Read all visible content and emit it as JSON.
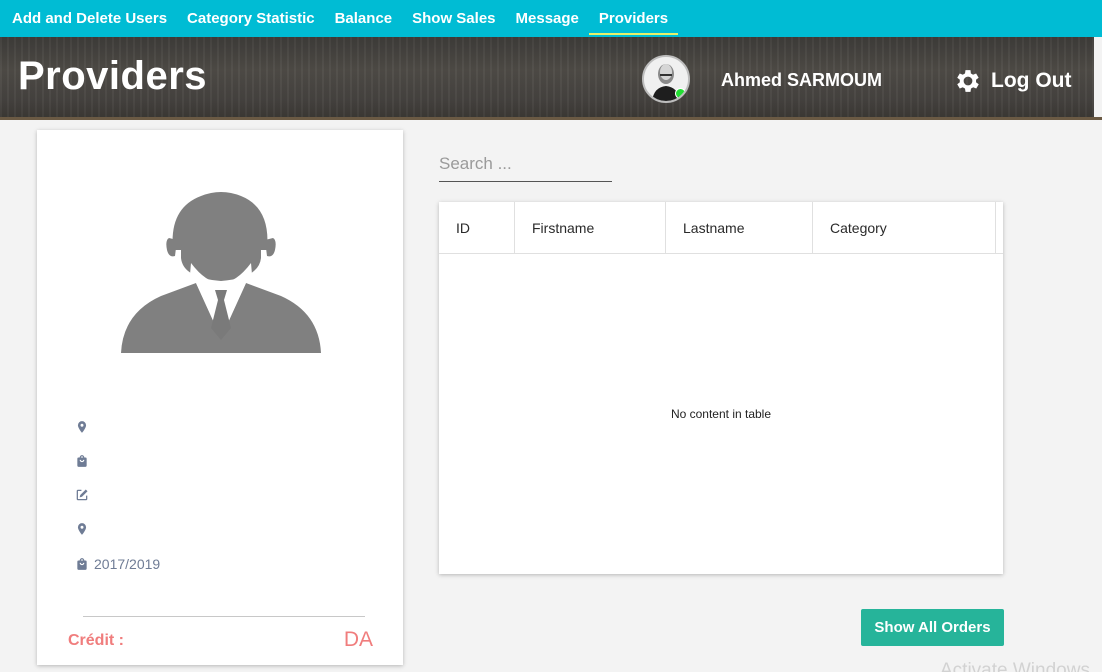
{
  "nav": {
    "items": [
      {
        "label": "Add and Delete Users"
      },
      {
        "label": "Category Statistic"
      },
      {
        "label": "Balance"
      },
      {
        "label": "Show Sales"
      },
      {
        "label": "Message"
      },
      {
        "label": "Providers",
        "active": true
      }
    ]
  },
  "header": {
    "title": "Providers",
    "user_name": "Ahmed SARMOUM",
    "logout_label": "Log Out"
  },
  "profile": {
    "rows": [
      {
        "icon": "location-pin-icon",
        "text": ""
      },
      {
        "icon": "shopping-bag-icon",
        "text": ""
      },
      {
        "icon": "edit-icon",
        "text": ""
      },
      {
        "icon": "location-pin-icon",
        "text": ""
      },
      {
        "icon": "shopping-bag-icon",
        "text": "2017/2019"
      }
    ],
    "credit_label": "Crédit :",
    "credit_unit": "DA"
  },
  "search": {
    "placeholder": "Search ...",
    "value": ""
  },
  "table": {
    "columns": [
      "ID",
      "Firstname",
      "Lastname",
      "Category"
    ],
    "rows": [],
    "empty_message": "No content in table"
  },
  "actions": {
    "show_orders_label": "Show All Orders"
  },
  "watermark": "Activate Windows",
  "colors": {
    "nav_bg": "#00bcd4",
    "active_underline": "#e8f06a",
    "button_bg": "#26b49a",
    "credit_text": "#f07d7d",
    "info_text": "#6f7c95"
  }
}
